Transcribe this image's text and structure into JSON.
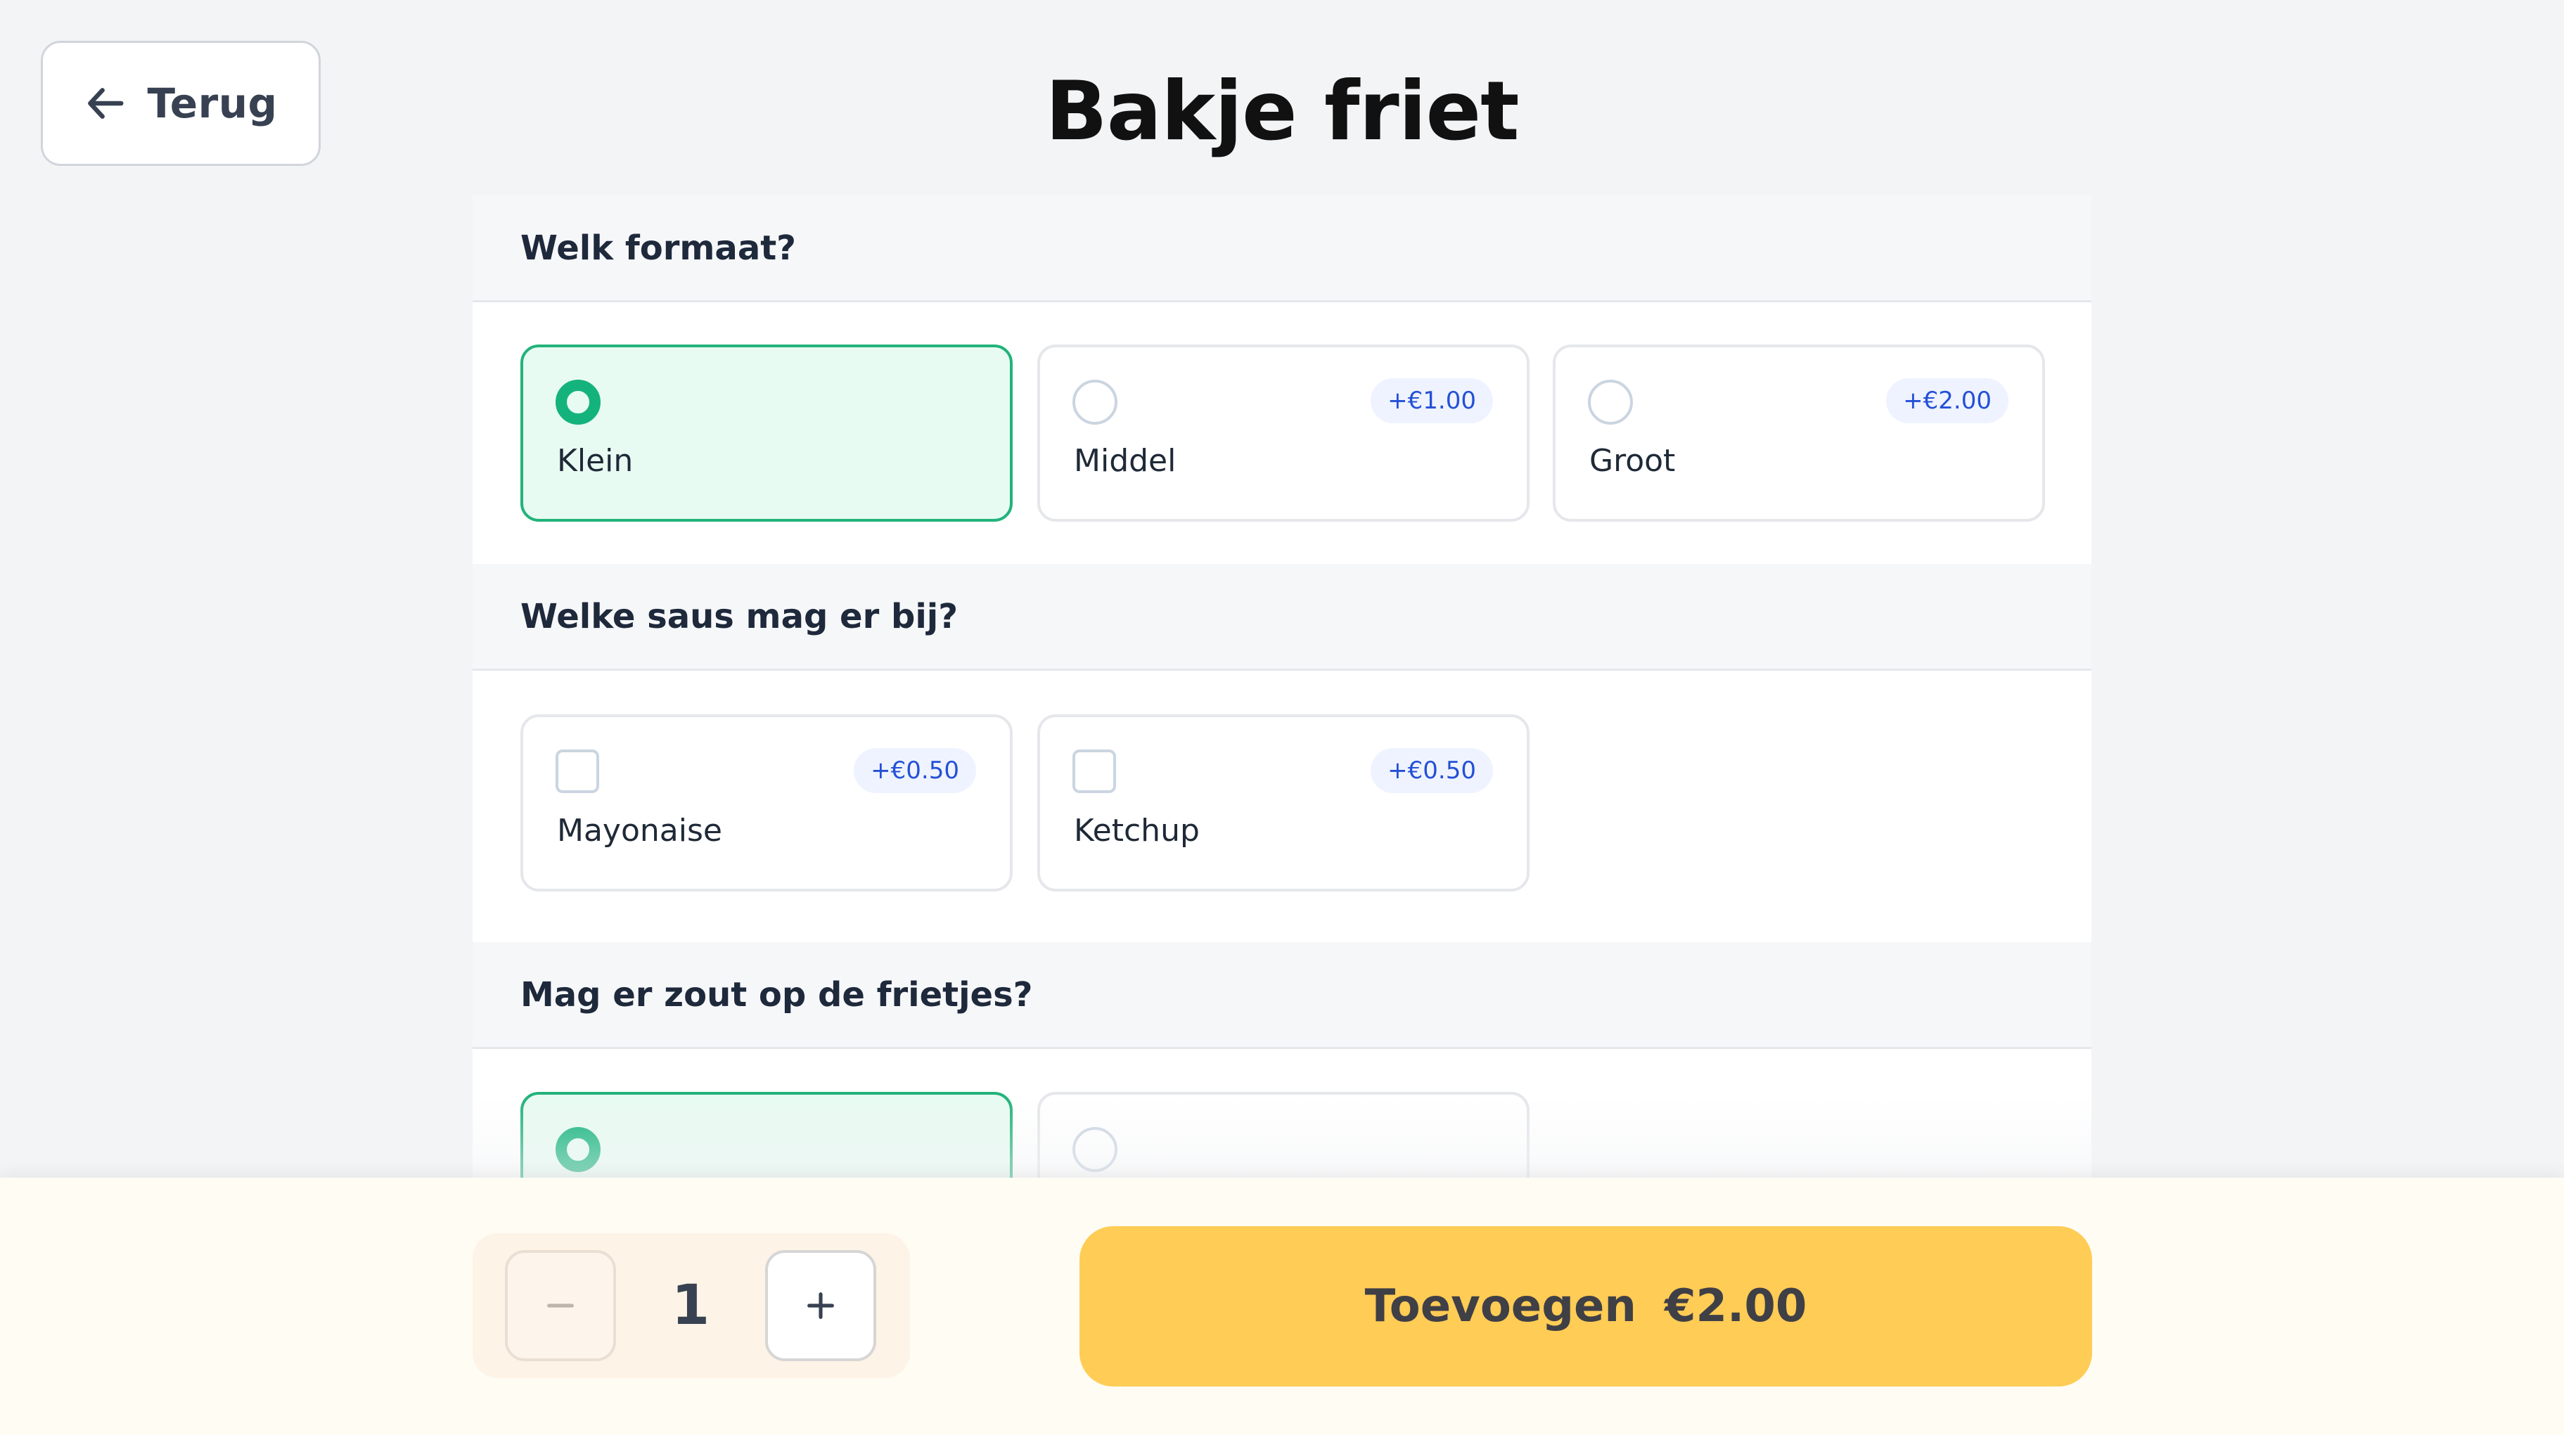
{
  "header": {
    "back_label": "Terug",
    "title": "Bakje friet"
  },
  "icons": {
    "back": "arrow-left-icon",
    "minus": "minus-icon",
    "plus": "plus-icon"
  },
  "sections": [
    {
      "title": "Welk formaat?",
      "input_type": "radio",
      "options": [
        {
          "label": "Klein",
          "price": "",
          "selected": true
        },
        {
          "label": "Middel",
          "price": "+€1.00",
          "selected": false
        },
        {
          "label": "Groot",
          "price": "+€2.00",
          "selected": false
        }
      ]
    },
    {
      "title": "Welke saus mag er bij?",
      "input_type": "checkbox",
      "options": [
        {
          "label": "Mayonaise",
          "price": "+€0.50",
          "selected": false
        },
        {
          "label": "Ketchup",
          "price": "+€0.50",
          "selected": false
        }
      ]
    },
    {
      "title": "Mag er zout op de frietjes?",
      "input_type": "radio",
      "options": [
        {
          "label": "",
          "price": "",
          "selected": true
        },
        {
          "label": "",
          "price": "",
          "selected": false
        }
      ]
    }
  ],
  "footer": {
    "quantity": "1",
    "add_label": "Toevoegen",
    "add_price": "€2.00"
  },
  "colors": {
    "accent_green": "#14b37d",
    "selected_bg": "#e8fbf2",
    "cta_yellow": "#ffcc55",
    "price_badge_text": "#2450d6",
    "price_badge_bg": "#eef3ff"
  }
}
